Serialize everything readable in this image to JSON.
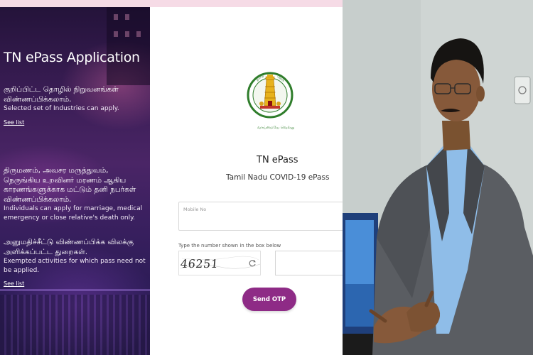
{
  "left_panel": {
    "app_title": "TN ePass Application",
    "sections": [
      {
        "tamil": "குறிப்பிட்ட தொழில் நிறுவனங்கள் விண்ணப்பிக்கலாம்.",
        "english": "Selected set of Industries can apply.",
        "link": "See list"
      },
      {
        "tamil": "திருமணம், அவசர மருத்துவம், நெருங்கிய உறவினர் மரணம் ஆகிய காரணங்களுக்காக மட்டும் தனி நபர்கள் விண்ணப்பிக்கலாம்.",
        "english": "Individuals can apply for marriage, medical emergency or close relative's death only."
      },
      {
        "tamil": "அனுமதிச்சீட்டு விண்ணப்பிக்க விலக்கு அளிக்கப்பட்ட துறைகள்.",
        "english": "Exempted activities for which pass need not be applied.",
        "link": "See list"
      }
    ]
  },
  "form": {
    "logo_icon": "tamil-nadu-emblem-icon",
    "title": "TN ePass",
    "subtitle": "Tamil Nadu COVID-19 ePass",
    "mobile_label": "Mobile No",
    "mobile_value": "",
    "captcha_label": "Type the number shown in the box below",
    "captcha_text": "46251",
    "captcha_input_value": "",
    "send_otp_label": "Send OTP",
    "refresh_icon": "refresh-icon"
  },
  "colors": {
    "accent": "#8e2b86",
    "top_band": "#f6dbe6",
    "left_panel": "#3a1d55"
  }
}
